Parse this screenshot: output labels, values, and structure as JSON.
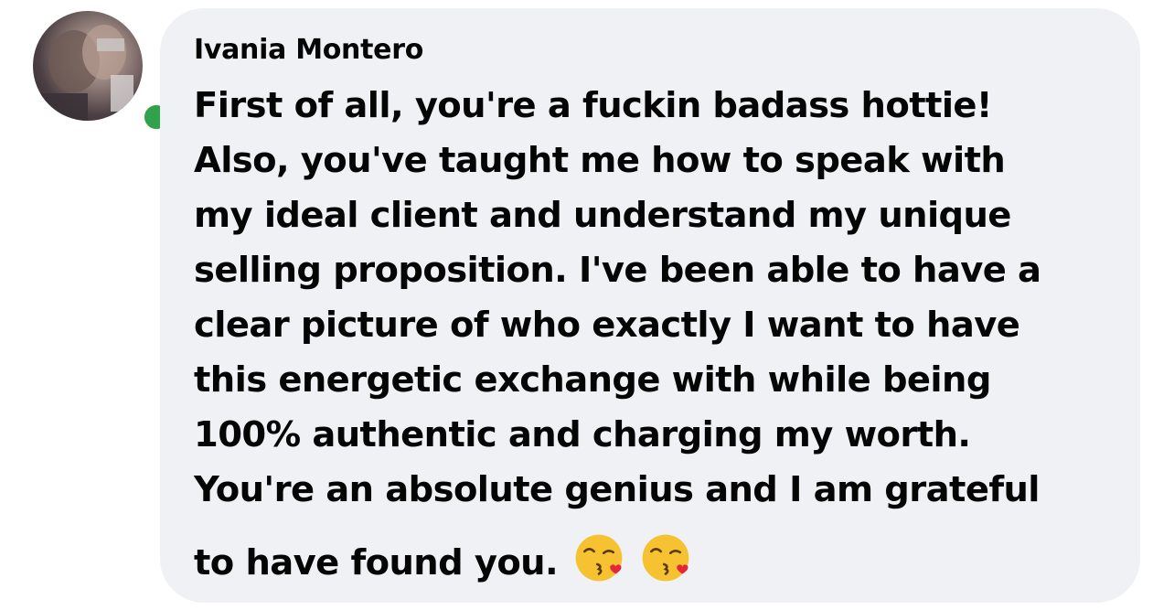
{
  "comment": {
    "author": "Ivania Montero",
    "lines": [
      "First of all, you're a fuckin badass hottie!",
      "Also, you've taught me how to speak with",
      "my ideal client and understand my unique",
      "selling proposition. I've been able to have a",
      "clear picture of who exactly I want to have",
      "this energetic exchange with while being",
      "100% authentic and charging my worth.",
      "You're an absolute genius and I am grateful",
      "to have found you."
    ],
    "emojis": [
      "face-blowing-a-kiss-icon",
      "face-blowing-a-kiss-icon"
    ]
  },
  "colors": {
    "bubble": "#f0f1f4",
    "text": "#050505",
    "presence": "#31a24c"
  }
}
